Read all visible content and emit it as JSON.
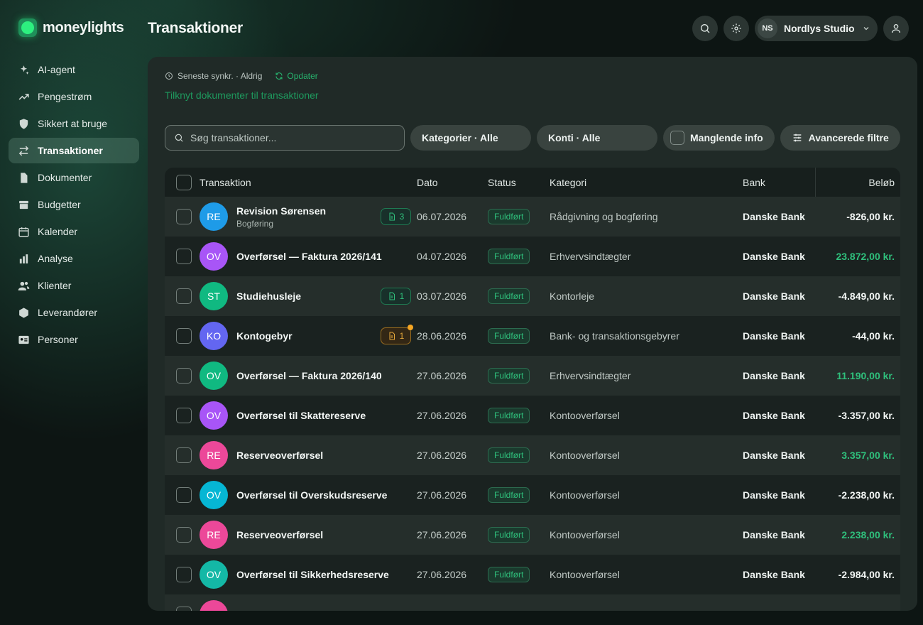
{
  "app": {
    "name": "moneylights"
  },
  "sidebar": {
    "items": [
      {
        "label": "AI-agent",
        "icon": "sparkles-icon",
        "active": false
      },
      {
        "label": "Pengestrøm",
        "icon": "trend-up-icon",
        "active": false
      },
      {
        "label": "Sikkert at bruge",
        "icon": "shield-icon",
        "active": false
      },
      {
        "label": "Transaktioner",
        "icon": "swap-arrows-icon",
        "active": true
      },
      {
        "label": "Dokumenter",
        "icon": "document-icon",
        "active": false
      },
      {
        "label": "Budgetter",
        "icon": "archive-box-icon",
        "active": false
      },
      {
        "label": "Kalender",
        "icon": "calendar-icon",
        "active": false
      },
      {
        "label": "Analyse",
        "icon": "bar-chart-icon",
        "active": false
      },
      {
        "label": "Klienter",
        "icon": "users-icon",
        "active": false
      },
      {
        "label": "Leverandører",
        "icon": "cube-icon",
        "active": false
      },
      {
        "label": "Personer",
        "icon": "id-card-icon",
        "active": false
      }
    ]
  },
  "header": {
    "title": "Transaktioner",
    "org_initials": "NS",
    "org_name": "Nordlys Studio"
  },
  "sync": {
    "text": "Seneste synkr. · Aldrig",
    "update_label": "Opdater",
    "link_docs": "Tilknyt dokumenter til transaktioner"
  },
  "filters": {
    "search_placeholder": "Søg transaktioner...",
    "categories": "Kategorier · Alle",
    "accounts": "Konti · Alle",
    "missing_info": "Manglende info",
    "advanced": "Avancerede filtre"
  },
  "table": {
    "headers": {
      "transaction": "Transaktion",
      "date": "Dato",
      "status": "Status",
      "category": "Kategori",
      "bank": "Bank",
      "amount": "Beløb"
    },
    "rows": [
      {
        "initials": "RE",
        "color": "#1e9be8",
        "name": "Revision Sørensen",
        "sub": "Bogføring",
        "attach": "3",
        "warn": false,
        "date": "06.07.2026",
        "status": "Fuldført",
        "category": "Rådgivning og bogføring",
        "bank": "Danske Bank",
        "amount": "-826,00 kr.",
        "positive": false
      },
      {
        "initials": "OV",
        "color": "#a855f7",
        "name": "Overførsel — Faktura 2026/141",
        "sub": "",
        "attach": "",
        "warn": false,
        "date": "04.07.2026",
        "status": "Fuldført",
        "category": "Erhvervsindtægter",
        "bank": "Danske Bank",
        "amount": "23.872,00 kr.",
        "positive": true
      },
      {
        "initials": "ST",
        "color": "#10b981",
        "name": "Studiehusleje",
        "sub": "",
        "attach": "1",
        "warn": false,
        "date": "03.07.2026",
        "status": "Fuldført",
        "category": "Kontorleje",
        "bank": "Danske Bank",
        "amount": "-4.849,00 kr.",
        "positive": false
      },
      {
        "initials": "KO",
        "color": "#6366f1",
        "name": "Kontogebyr",
        "sub": "",
        "attach": "1",
        "warn": true,
        "date": "28.06.2026",
        "status": "Fuldført",
        "category": "Bank- og transaktionsgebyrer",
        "bank": "Danske Bank",
        "amount": "-44,00 kr.",
        "positive": false
      },
      {
        "initials": "OV",
        "color": "#10b981",
        "name": "Overførsel — Faktura 2026/140",
        "sub": "",
        "attach": "",
        "warn": false,
        "date": "27.06.2026",
        "status": "Fuldført",
        "category": "Erhvervsindtægter",
        "bank": "Danske Bank",
        "amount": "11.190,00 kr.",
        "positive": true
      },
      {
        "initials": "OV",
        "color": "#a855f7",
        "name": "Overførsel til Skattereserve",
        "sub": "",
        "attach": "",
        "warn": false,
        "date": "27.06.2026",
        "status": "Fuldført",
        "category": "Kontooverførsel",
        "bank": "Danske Bank",
        "amount": "-3.357,00 kr.",
        "positive": false
      },
      {
        "initials": "RE",
        "color": "#ec4899",
        "name": "Reserveoverførsel",
        "sub": "",
        "attach": "",
        "warn": false,
        "date": "27.06.2026",
        "status": "Fuldført",
        "category": "Kontooverførsel",
        "bank": "Danske Bank",
        "amount": "3.357,00 kr.",
        "positive": true
      },
      {
        "initials": "OV",
        "color": "#06b6d4",
        "name": "Overførsel til Overskudsreserve",
        "sub": "",
        "attach": "",
        "warn": false,
        "date": "27.06.2026",
        "status": "Fuldført",
        "category": "Kontooverførsel",
        "bank": "Danske Bank",
        "amount": "-2.238,00 kr.",
        "positive": false
      },
      {
        "initials": "RE",
        "color": "#ec4899",
        "name": "Reserveoverførsel",
        "sub": "",
        "attach": "",
        "warn": false,
        "date": "27.06.2026",
        "status": "Fuldført",
        "category": "Kontooverførsel",
        "bank": "Danske Bank",
        "amount": "2.238,00 kr.",
        "positive": true
      },
      {
        "initials": "OV",
        "color": "#14b8a6",
        "name": "Overførsel til Sikkerhedsreserve",
        "sub": "",
        "attach": "",
        "warn": false,
        "date": "27.06.2026",
        "status": "Fuldført",
        "category": "Kontooverførsel",
        "bank": "Danske Bank",
        "amount": "-2.984,00 kr.",
        "positive": false
      },
      {
        "initials": "",
        "color": "#ec4899",
        "name": "",
        "sub": "",
        "attach": "",
        "warn": false,
        "date": "",
        "status": "",
        "category": "",
        "bank": "",
        "amount": "",
        "positive": false
      }
    ]
  }
}
